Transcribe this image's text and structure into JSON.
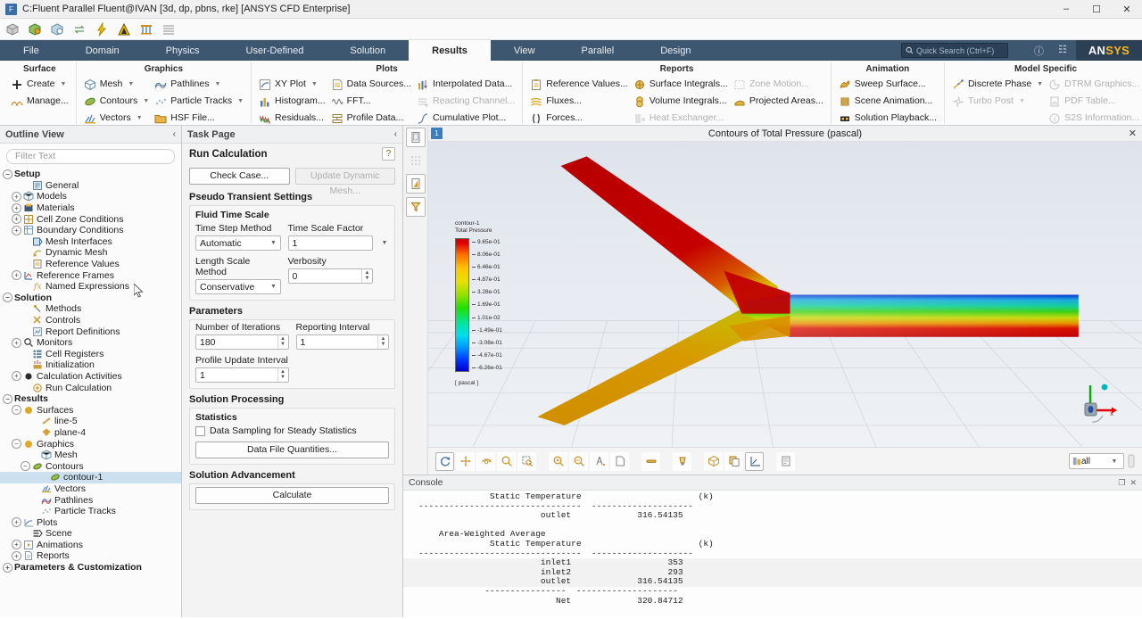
{
  "window": {
    "title": "C:Fluent Parallel Fluent@IVAN  [3d, dp, pbns, rke] [ANSYS CFD Enterprise]",
    "app_icon": "fluent-icon",
    "minimize": "–",
    "maximize": "☐",
    "close": "✕"
  },
  "quick_access": [
    {
      "name": "mesh-display-icon"
    },
    {
      "name": "mesh-quality-icon"
    },
    {
      "name": "mesh-info-icon"
    },
    {
      "name": "transfer-icon"
    },
    {
      "name": "run-calculation-icon"
    },
    {
      "name": "ansys-workbench-icon"
    },
    {
      "name": "results-icon"
    },
    {
      "name": "table-icon"
    }
  ],
  "ribbon": {
    "tabs": [
      {
        "label": "File",
        "active": false
      },
      {
        "label": "Domain",
        "active": false
      },
      {
        "label": "Physics",
        "active": false
      },
      {
        "label": "User-Defined",
        "active": false
      },
      {
        "label": "Solution",
        "active": false
      },
      {
        "label": "Results",
        "active": true
      },
      {
        "label": "View",
        "active": false
      },
      {
        "label": "Parallel",
        "active": false
      },
      {
        "label": "Design",
        "active": false
      }
    ],
    "collapse_icon": "▲",
    "search": {
      "placeholder": "Quick Search (Ctrl+F)",
      "icon": "search-icon"
    },
    "help_icon": "help-icon",
    "layout_icon": "panel-layout-icon",
    "brand": {
      "prefix": "AN",
      "suffix": "SYS"
    },
    "groups": [
      {
        "title": "Surface",
        "columns": [
          [
            {
              "label": "Create",
              "icon": "plus-icon",
              "caret": true,
              "disabled": false
            },
            {
              "label": "Manage...",
              "icon": "manage-surface-icon",
              "caret": false,
              "disabled": false
            }
          ]
        ]
      },
      {
        "title": "Graphics",
        "columns": [
          [
            {
              "label": "Mesh",
              "icon": "mesh-icon",
              "caret": true,
              "disabled": false
            },
            {
              "label": "Contours",
              "icon": "contours-icon",
              "caret": true,
              "disabled": false
            },
            {
              "label": "Vectors",
              "icon": "vectors-icon",
              "caret": true,
              "disabled": false
            }
          ],
          [
            {
              "label": "Pathlines",
              "icon": "pathlines-icon",
              "caret": true,
              "disabled": false
            },
            {
              "label": "Particle Tracks",
              "icon": "particle-tracks-icon",
              "caret": true,
              "disabled": false
            },
            {
              "label": "HSF File...",
              "icon": "folder-icon",
              "caret": false,
              "disabled": false
            }
          ]
        ]
      },
      {
        "title": "Plots",
        "columns": [
          [
            {
              "label": "XY Plot",
              "icon": "xy-plot-icon",
              "caret": true,
              "disabled": false
            },
            {
              "label": "Histogram...",
              "icon": "histogram-icon",
              "caret": false,
              "disabled": false
            },
            {
              "label": "Residuals...",
              "icon": "residuals-icon",
              "caret": false,
              "disabled": false
            }
          ],
          [
            {
              "label": "Data Sources...",
              "icon": "data-sources-icon",
              "caret": false,
              "disabled": false
            },
            {
              "label": "FFT...",
              "icon": "fft-icon",
              "caret": false,
              "disabled": false
            },
            {
              "label": "Profile Data...",
              "icon": "profile-data-icon",
              "caret": false,
              "disabled": false
            }
          ],
          [
            {
              "label": "Interpolated Data...",
              "icon": "interpolated-data-icon",
              "caret": false,
              "disabled": false
            },
            {
              "label": "Reacting Channel...",
              "icon": "reacting-channel-icon",
              "caret": false,
              "disabled": true
            },
            {
              "label": "Cumulative Plot...",
              "icon": "cumulative-plot-icon",
              "caret": false,
              "disabled": false
            }
          ]
        ]
      },
      {
        "title": "Reports",
        "columns": [
          [
            {
              "label": "Reference Values...",
              "icon": "reference-values-icon",
              "caret": false,
              "disabled": false
            },
            {
              "label": "Fluxes...",
              "icon": "fluxes-icon",
              "caret": false,
              "disabled": false
            },
            {
              "label": "Forces...",
              "icon": "forces-icon",
              "caret": false,
              "disabled": false
            }
          ],
          [
            {
              "label": "Surface Integrals...",
              "icon": "surface-integrals-icon",
              "caret": false,
              "disabled": false
            },
            {
              "label": "Volume Integrals...",
              "icon": "volume-integrals-icon",
              "caret": false,
              "disabled": false
            },
            {
              "label": "Heat Exchanger...",
              "icon": "heat-exchanger-icon",
              "caret": false,
              "disabled": true
            }
          ],
          [
            {
              "label": "Zone Motion...",
              "icon": "zone-motion-icon",
              "caret": false,
              "disabled": true
            },
            {
              "label": "Projected Areas...",
              "icon": "projected-areas-icon",
              "caret": false,
              "disabled": false
            }
          ]
        ]
      },
      {
        "title": "Animation",
        "columns": [
          [
            {
              "label": "Sweep Surface...",
              "icon": "sweep-surface-icon",
              "caret": false,
              "disabled": false
            },
            {
              "label": "Scene Animation...",
              "icon": "scene-animation-icon",
              "caret": false,
              "disabled": false
            },
            {
              "label": "Solution Playback...",
              "icon": "solution-playback-icon",
              "caret": false,
              "disabled": false
            }
          ]
        ]
      },
      {
        "title": "Model Specific",
        "columns": [
          [
            {
              "label": "Discrete Phase",
              "icon": "discrete-phase-icon",
              "caret": true,
              "disabled": false
            },
            {
              "label": "Turbo Post",
              "icon": "turbo-post-icon",
              "caret": true,
              "disabled": true
            }
          ],
          [
            {
              "label": "DTRM Graphics...",
              "icon": "dtrm-graphics-icon",
              "caret": false,
              "disabled": true
            },
            {
              "label": "PDF Table...",
              "icon": "pdf-table-icon",
              "caret": false,
              "disabled": true
            },
            {
              "label": "S2S Information...",
              "icon": "s2s-information-icon",
              "caret": false,
              "disabled": true
            }
          ]
        ]
      }
    ]
  },
  "outline": {
    "title": "Outline View",
    "collapse_icon": "‹",
    "filter_placeholder": "Filter Text",
    "nodes": [
      {
        "label": "Setup",
        "indent": 0,
        "bold": true,
        "expander": "minus",
        "icon": "",
        "selected": false
      },
      {
        "label": "General",
        "indent": 2,
        "bold": false,
        "expander": "none",
        "icon": "general-icon",
        "selected": false
      },
      {
        "label": "Models",
        "indent": 1,
        "bold": false,
        "expander": "plus",
        "icon": "models-icon",
        "selected": false
      },
      {
        "label": "Materials",
        "indent": 1,
        "bold": false,
        "expander": "plus",
        "icon": "materials-icon",
        "selected": false
      },
      {
        "label": "Cell Zone Conditions",
        "indent": 1,
        "bold": false,
        "expander": "plus",
        "icon": "cell-zone-icon",
        "selected": false
      },
      {
        "label": "Boundary Conditions",
        "indent": 1,
        "bold": false,
        "expander": "plus",
        "icon": "boundary-conditions-icon",
        "selected": false
      },
      {
        "label": "Mesh Interfaces",
        "indent": 2,
        "bold": false,
        "expander": "none",
        "icon": "mesh-interfaces-icon",
        "selected": false
      },
      {
        "label": "Dynamic Mesh",
        "indent": 2,
        "bold": false,
        "expander": "none",
        "icon": "dynamic-mesh-icon",
        "selected": false
      },
      {
        "label": "Reference Values",
        "indent": 2,
        "bold": false,
        "expander": "none",
        "icon": "reference-values-icon",
        "selected": false
      },
      {
        "label": "Reference Frames",
        "indent": 1,
        "bold": false,
        "expander": "plus",
        "icon": "reference-frames-icon",
        "selected": false
      },
      {
        "label": "Named Expressions",
        "indent": 2,
        "bold": false,
        "expander": "none",
        "icon": "named-expressions-icon",
        "selected": false
      },
      {
        "label": "Solution",
        "indent": 0,
        "bold": true,
        "expander": "minus",
        "icon": "",
        "selected": false
      },
      {
        "label": "Methods",
        "indent": 2,
        "bold": false,
        "expander": "none",
        "icon": "methods-icon",
        "selected": false
      },
      {
        "label": "Controls",
        "indent": 2,
        "bold": false,
        "expander": "none",
        "icon": "controls-icon",
        "selected": false
      },
      {
        "label": "Report Definitions",
        "indent": 2,
        "bold": false,
        "expander": "none",
        "icon": "report-definitions-icon",
        "selected": false
      },
      {
        "label": "Monitors",
        "indent": 1,
        "bold": false,
        "expander": "plus",
        "icon": "monitors-icon",
        "selected": false
      },
      {
        "label": "Cell Registers",
        "indent": 2,
        "bold": false,
        "expander": "none",
        "icon": "cell-registers-icon",
        "selected": false
      },
      {
        "label": "Initialization",
        "indent": 2,
        "bold": false,
        "expander": "none",
        "icon": "initialization-icon",
        "selected": false
      },
      {
        "label": "Calculation Activities",
        "indent": 1,
        "bold": false,
        "expander": "plus",
        "icon": "calculation-activities-icon",
        "selected": false
      },
      {
        "label": "Run Calculation",
        "indent": 2,
        "bold": false,
        "expander": "none",
        "icon": "run-calculation-icon",
        "selected": false
      },
      {
        "label": "Results",
        "indent": 0,
        "bold": true,
        "expander": "minus",
        "icon": "",
        "selected": false
      },
      {
        "label": "Surfaces",
        "indent": 1,
        "bold": false,
        "expander": "minus",
        "icon": "surfaces-icon",
        "selected": false
      },
      {
        "label": "line-5",
        "indent": 3,
        "bold": false,
        "expander": "none",
        "icon": "line-surface-icon",
        "selected": false
      },
      {
        "label": "plane-4",
        "indent": 3,
        "bold": false,
        "expander": "none",
        "icon": "plane-surface-icon",
        "selected": false
      },
      {
        "label": "Graphics",
        "indent": 1,
        "bold": false,
        "expander": "minus",
        "icon": "graphics-icon",
        "selected": false
      },
      {
        "label": "Mesh",
        "indent": 3,
        "bold": false,
        "expander": "none",
        "icon": "mesh-icon",
        "selected": false
      },
      {
        "label": "Contours",
        "indent": 2,
        "bold": false,
        "expander": "minus",
        "icon": "contours-icon",
        "selected": false
      },
      {
        "label": "contour-1",
        "indent": 4,
        "bold": false,
        "expander": "none",
        "icon": "contours-icon",
        "selected": true
      },
      {
        "label": "Vectors",
        "indent": 3,
        "bold": false,
        "expander": "none",
        "icon": "vectors-icon",
        "selected": false
      },
      {
        "label": "Pathlines",
        "indent": 3,
        "bold": false,
        "expander": "none",
        "icon": "pathlines-icon",
        "selected": false
      },
      {
        "label": "Particle Tracks",
        "indent": 3,
        "bold": false,
        "expander": "none",
        "icon": "particle-tracks-icon",
        "selected": false
      },
      {
        "label": "Plots",
        "indent": 1,
        "bold": false,
        "expander": "plus",
        "icon": "xy-plot-icon",
        "selected": false
      },
      {
        "label": "Scene",
        "indent": 2,
        "bold": false,
        "expander": "none",
        "icon": "scene-icon",
        "selected": false
      },
      {
        "label": "Animations",
        "indent": 1,
        "bold": false,
        "expander": "plus",
        "icon": "animations-icon",
        "selected": false
      },
      {
        "label": "Reports",
        "indent": 1,
        "bold": false,
        "expander": "plus",
        "icon": "reports-icon",
        "selected": false
      },
      {
        "label": "Parameters & Customization",
        "indent": 0,
        "bold": true,
        "expander": "plus",
        "icon": "",
        "selected": false
      }
    ]
  },
  "task_page": {
    "title": "Task Page",
    "collapse_icon": "‹",
    "heading": "Run Calculation",
    "help_icon": "?",
    "check_case_label": "Check Case...",
    "update_dynamic_mesh_label": "Update Dynamic Mesh...",
    "pseudo_transient_title": "Pseudo Transient Settings",
    "fluid_time_scale_title": "Fluid Time Scale",
    "time_step_method": {
      "label": "Time Step Method",
      "value": "Automatic"
    },
    "time_scale_factor": {
      "label": "Time Scale Factor",
      "value": "1"
    },
    "length_scale_method": {
      "label": "Length Scale Method",
      "value": "Conservative"
    },
    "verbosity": {
      "label": "Verbosity",
      "value": "0"
    },
    "parameters_title": "Parameters",
    "number_of_iterations": {
      "label": "Number of Iterations",
      "value": "180"
    },
    "reporting_interval": {
      "label": "Reporting Interval",
      "value": "1"
    },
    "profile_update_interval": {
      "label": "Profile Update Interval",
      "value": "1"
    },
    "solution_processing_title": "Solution Processing",
    "statistics_title": "Statistics",
    "data_sampling_label": "Data Sampling for Steady Statistics",
    "data_file_quantities_label": "Data File Quantities...",
    "solution_advancement_title": "Solution Advancement",
    "calculate_label": "Calculate"
  },
  "graphics": {
    "window_tag": "1",
    "title": "Contours of Total Pressure (pascal)",
    "close_icon": "✕",
    "left_strip": [
      {
        "name": "graphics-window-icon"
      },
      {
        "name": "grid-dots-icon"
      },
      {
        "name": "contour-preview-icon"
      },
      {
        "name": "funnel-filter-icon"
      }
    ],
    "toolbar": [
      {
        "name": "refresh-view-icon",
        "framed": true
      },
      {
        "name": "pan-icon",
        "framed": false
      },
      {
        "name": "rotate-icon",
        "framed": false
      },
      {
        "name": "zoom-icon",
        "framed": false
      },
      {
        "name": "zoom-to-box-icon",
        "framed": false
      },
      {
        "name": "zoom-in-icon",
        "framed": false
      },
      {
        "name": "zoom-out-icon",
        "framed": false
      },
      {
        "name": "fit-to-window-icon",
        "framed": false
      },
      {
        "name": "reset-view-icon",
        "framed": false
      },
      {
        "name": "ruler-icon",
        "framed": false
      },
      {
        "name": "lighting-icon",
        "framed": false
      },
      {
        "name": "orientation-cube-icon",
        "framed": false
      },
      {
        "name": "copy-view-icon",
        "framed": false
      },
      {
        "name": "axes-icon",
        "framed": true
      },
      {
        "name": "legend-icon",
        "framed": false
      }
    ],
    "view_select": {
      "value": "all",
      "icon": "view-list-icon"
    },
    "legend": {
      "name": "contour-1",
      "variable": "Total Pressure",
      "unit": "[ pascal ]",
      "ticks": [
        "9.65e-01",
        "8.06e-01",
        "6.46e-01",
        "4.87e-01",
        "3.28e-01",
        "1.69e-01",
        "1.01e-02",
        "-1.49e-01",
        "-3.08e-01",
        "-4.67e-01",
        "-6.26e-01"
      ]
    },
    "axis_triad": {
      "x": "x",
      "y": "y",
      "z": "z"
    }
  },
  "console": {
    "title": "Console",
    "lines": [
      {
        "text": "                 Static Temperature                       (k)",
        "hl": false
      },
      {
        "text": "   --------------------------------  --------------------",
        "hl": false
      },
      {
        "text": "                           outlet             316.54135",
        "hl": false
      },
      {
        "text": "",
        "hl": false
      },
      {
        "text": "       Area-Weighted Average",
        "hl": false
      },
      {
        "text": "                 Static Temperature                       (k)",
        "hl": false
      },
      {
        "text": "   --------------------------------  --------------------",
        "hl": false
      },
      {
        "text": "                           inlet1                   353",
        "hl": true
      },
      {
        "text": "                           inlet2                   293",
        "hl": true
      },
      {
        "text": "                           outlet             316.54135",
        "hl": true
      },
      {
        "text": "                ----------------  --------------------",
        "hl": false
      },
      {
        "text": "                              Net             320.84712",
        "hl": false
      }
    ]
  }
}
